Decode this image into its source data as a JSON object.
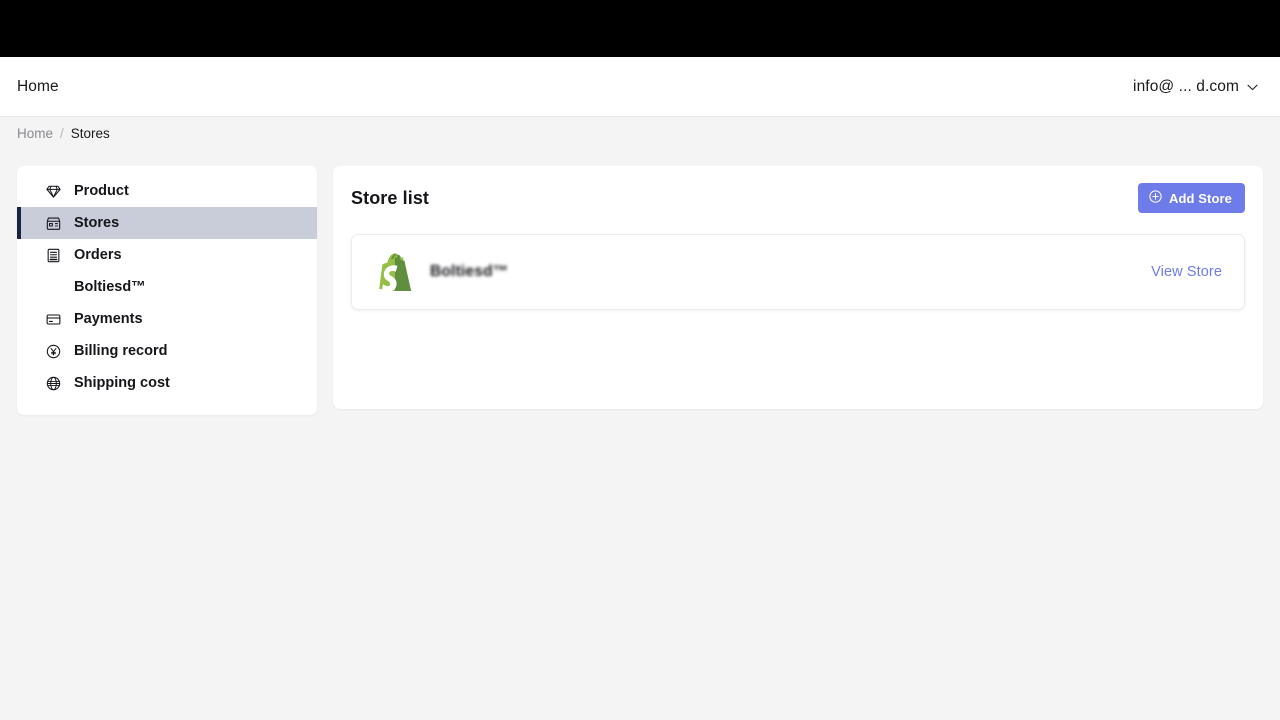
{
  "browser": {
    "chrome_bar": ""
  },
  "header": {
    "home_label": "Home",
    "account_email": "info@ ... d.com",
    "chevron_icon": "chevron-down-icon"
  },
  "breadcrumb": {
    "items": [
      {
        "label": "Home",
        "active": false
      },
      {
        "label": "Stores",
        "active": true
      }
    ],
    "separator": "/"
  },
  "sidebar": {
    "items": [
      {
        "label": "Product",
        "icon": "diamond-icon",
        "active": false
      },
      {
        "label": "Stores",
        "icon": "storefront-icon",
        "active": true
      },
      {
        "label": "Orders",
        "icon": "order-list-icon",
        "active": false
      },
      {
        "label": "Boltiesd™",
        "icon": "",
        "active": false,
        "sub": true
      },
      {
        "label": "Payments",
        "icon": "credit-card-icon",
        "active": false
      },
      {
        "label": "Billing record",
        "icon": "currency-circle-icon",
        "active": false
      },
      {
        "label": "Shipping cost",
        "icon": "globe-icon",
        "active": false
      }
    ]
  },
  "main": {
    "title": "Store list",
    "add_store_label": "Add Store",
    "add_store_icon": "plus-circle-icon",
    "stores": [
      {
        "name": "Boltiesd™",
        "logo_icon": "shopify-bag-icon",
        "action_label": "View Store"
      }
    ]
  },
  "colors": {
    "accent": "#6d7ce8",
    "active_nav_bg": "#c9ccd9",
    "active_nav_bar": "#1b2244",
    "page_bg": "#f4f4f5",
    "shopify_green": "#7ab55c",
    "chrome_black": "#000000"
  }
}
